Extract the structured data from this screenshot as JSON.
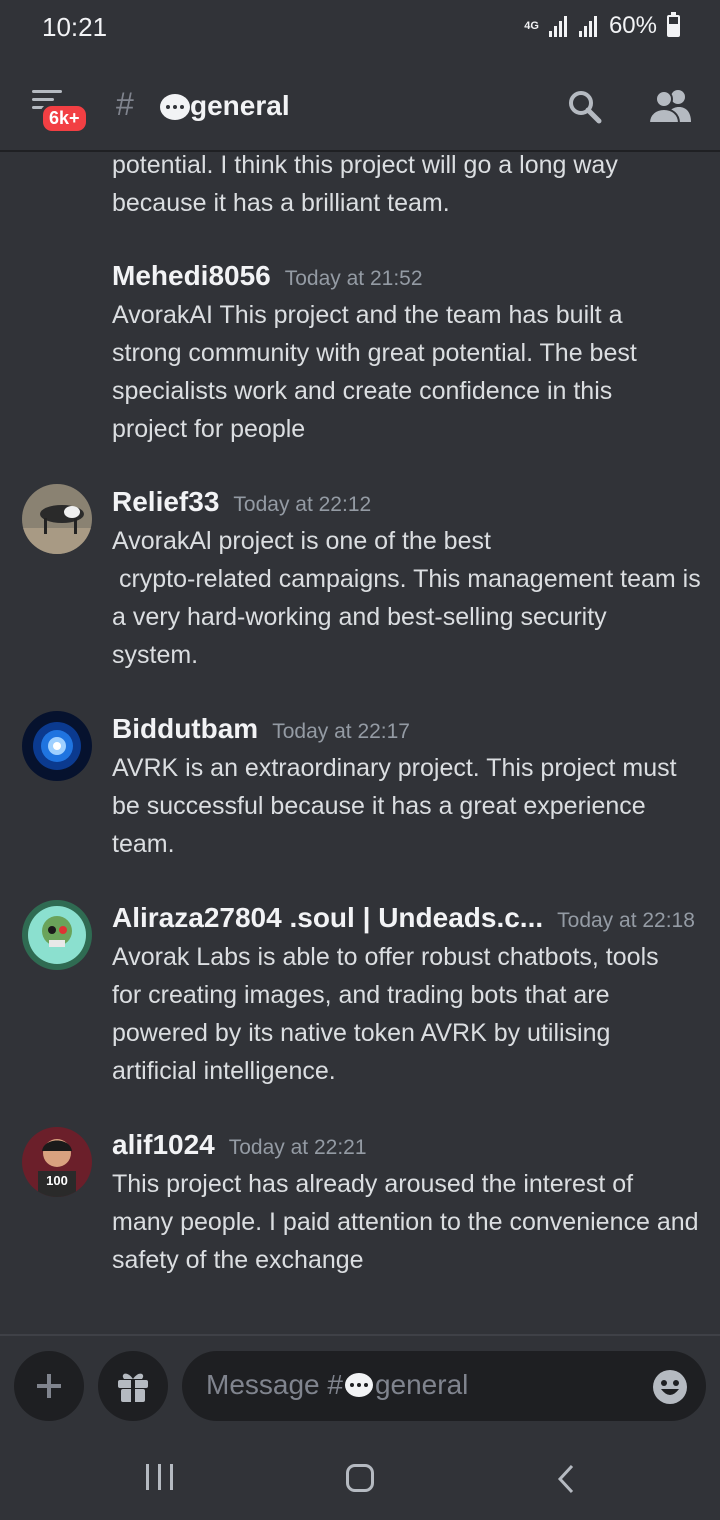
{
  "status": {
    "time": "10:21",
    "network": "4G",
    "battery": "60%",
    "battery_level": 0.6
  },
  "header": {
    "unread_badge": "6k+",
    "channel_hash": "#",
    "channel_name": "general",
    "icons": [
      "hamburger-menu-icon",
      "chat-bubble-icon",
      "search-icon",
      "members-icon"
    ]
  },
  "messages": [
    {
      "author": "",
      "timestamp": "",
      "text": "potential. I think this project will go a long way\nbecause it has a brilliant team."
    },
    {
      "author": "Mehedi8056",
      "timestamp": "Today at 21:52",
      "text": "AvorakAI This project and the team has built a\nstrong community with great potential. The best\nspecialists work and create confidence in this\nproject for people"
    },
    {
      "author": "Relief33",
      "timestamp": "Today at 22:12",
      "text": "AvorakAl project is one of the best\n crypto-related campaigns. This management team is\na very hard-working and best-selling security\nsystem."
    },
    {
      "author": "Biddutbam",
      "timestamp": "Today at 22:17",
      "text": "AVRK is an extraordinary project. This project must\nbe successful because it has a great experience\nteam."
    },
    {
      "author": "Aliraza27804 .soul | Undeads.c...",
      "timestamp": "Today at 22:18",
      "text": "Avorak Labs is able to offer robust chatbots, tools\nfor creating images, and trading bots that are\npowered by its native token AVRK by utilising\nartificial intelligence."
    },
    {
      "author": "alif1024",
      "timestamp": "Today at 22:21",
      "text": "This project has already aroused the interest of\nmany people. I paid attention to the convenience and\nsafety of the exchange",
      "avatar_label": "100"
    }
  ],
  "composer": {
    "placeholder_prefix": "Message #",
    "placeholder_channel": "general",
    "icons": [
      "plus-icon",
      "gift-icon",
      "emoji-icon"
    ]
  },
  "colors": {
    "background": "#313338",
    "badge": "#f23f43",
    "input": "#1e1f22",
    "muted": "#949ba4"
  }
}
